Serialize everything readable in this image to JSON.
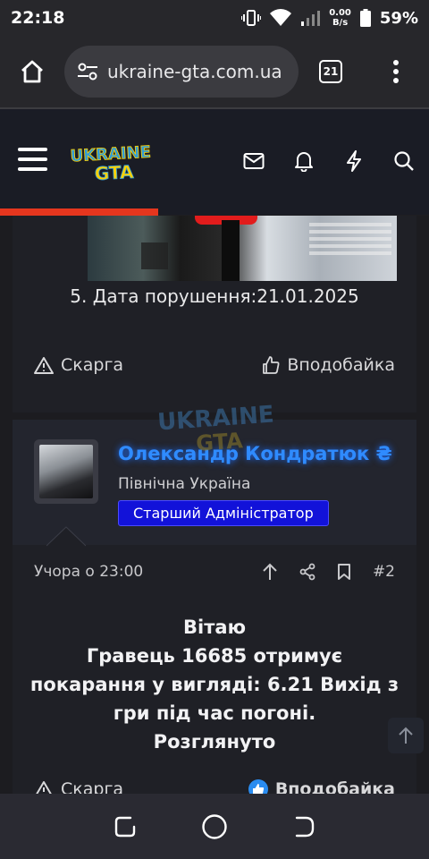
{
  "status_bar": {
    "time": "22:18",
    "net_speed_value": "0.00",
    "net_speed_unit": "B/s",
    "battery": "59%"
  },
  "browser": {
    "url": "ukraine-gta.com.ua",
    "tab_count": "21"
  },
  "site_header": {
    "logo_top": "UKRAINE",
    "logo_bottom": "GTA",
    "accent_color": "#e5361e"
  },
  "post1": {
    "body_line": "5. Дата порушення:21.01.2025",
    "report_label": "Скарга",
    "like_label": "Вподобайка"
  },
  "post2": {
    "username": "Олександр Кондратюк ₴",
    "region": "Північна Україна",
    "role": "Старший Адміністратор",
    "timestamp": "Учора о 23:00",
    "post_number": "#2",
    "body_lines": [
      "Вітаю",
      "Гравець 16685 отримує",
      "покарання у вигляді: 6.21 Вихід з",
      "гри під час погоні.",
      "Розглянуто"
    ],
    "report_label": "Скарга",
    "like_label": "Вподобайка"
  },
  "icons": {
    "home": "home-icon",
    "site_settings": "tune-icon",
    "tabs": "tabs-icon",
    "overflow": "more-vert-icon",
    "menu": "hamburger-icon",
    "inbox": "mail-icon",
    "alerts": "bell-icon",
    "whats_new": "bolt-icon",
    "search": "search-icon"
  }
}
